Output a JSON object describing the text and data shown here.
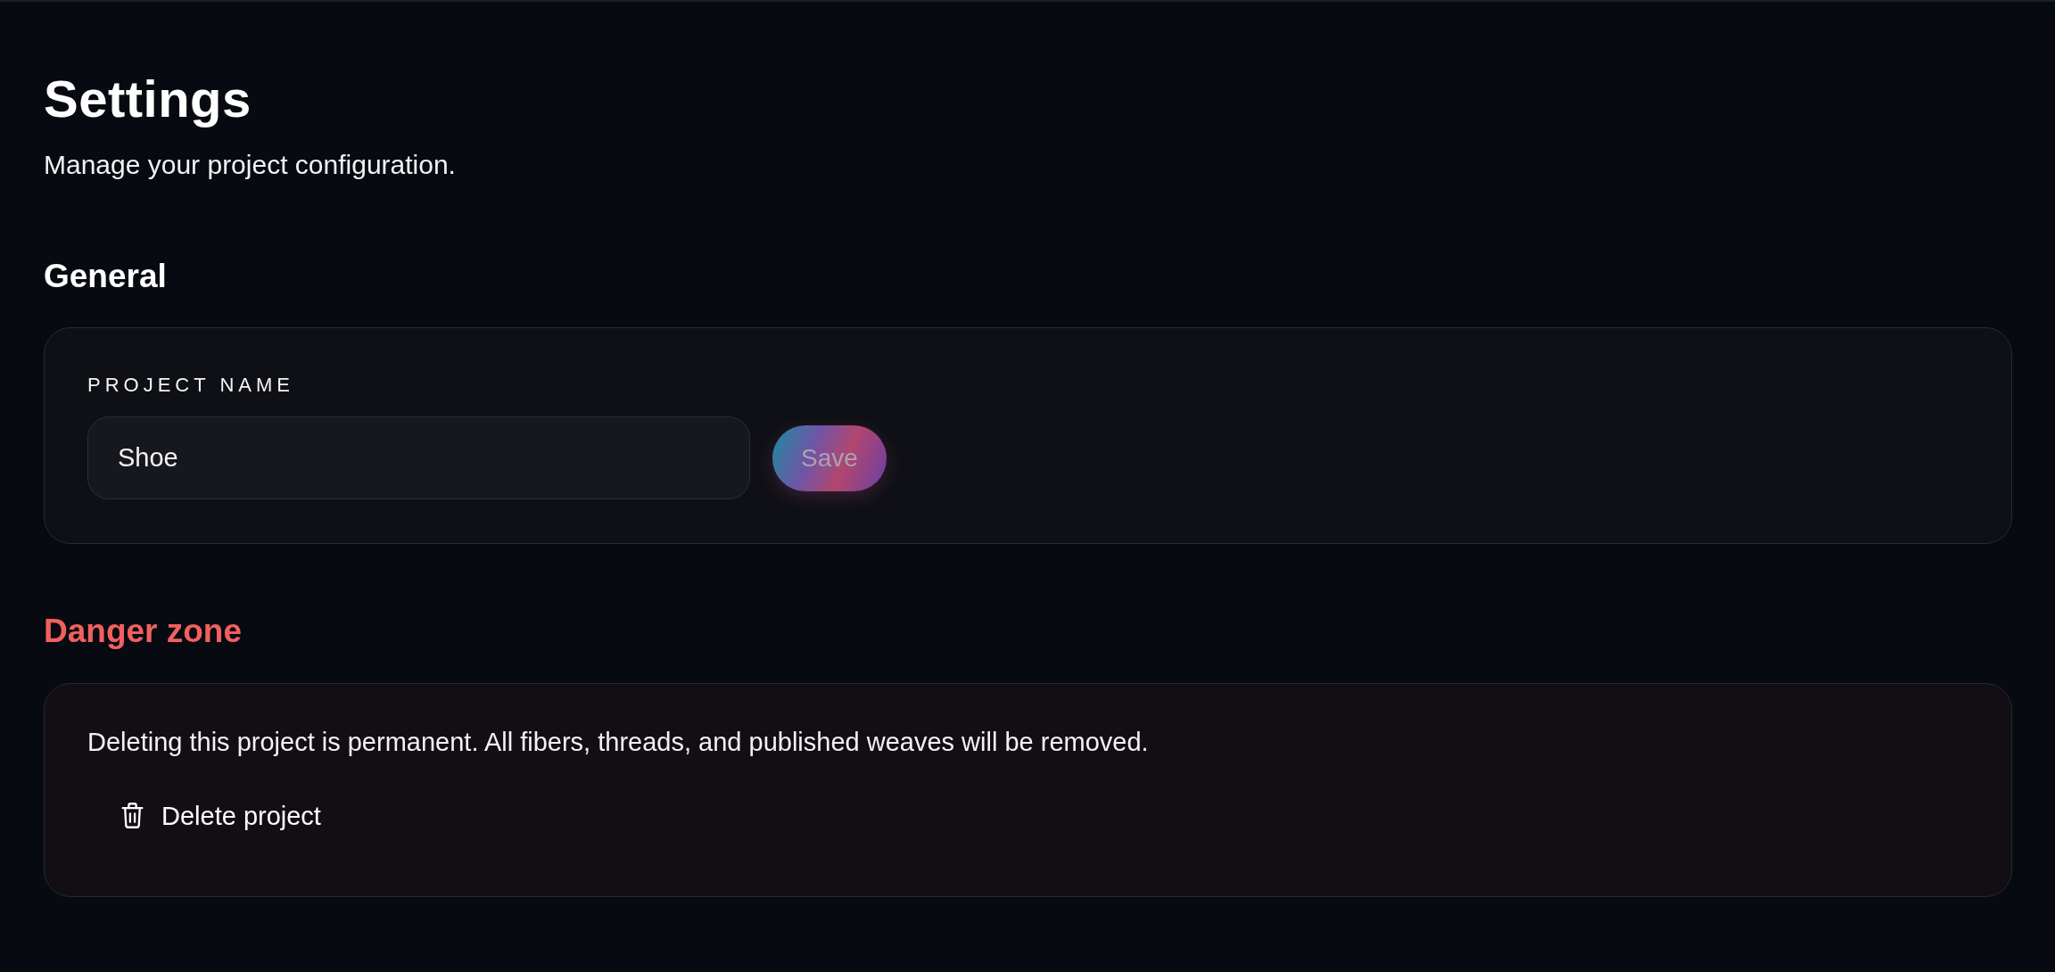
{
  "page": {
    "title": "Settings",
    "subtitle": "Manage your project configuration."
  },
  "sections": [
    {
      "kind": "general",
      "heading": "General",
      "field": {
        "label": "PROJECT NAME",
        "value": "Shoe"
      },
      "button": {
        "label": "Save",
        "disabled": true
      }
    },
    {
      "kind": "danger",
      "heading": "Danger zone",
      "description": "Deleting this project is permanent. All fibers, threads, and published weaves will be removed.",
      "button": {
        "label": "Delete project"
      }
    }
  ]
}
